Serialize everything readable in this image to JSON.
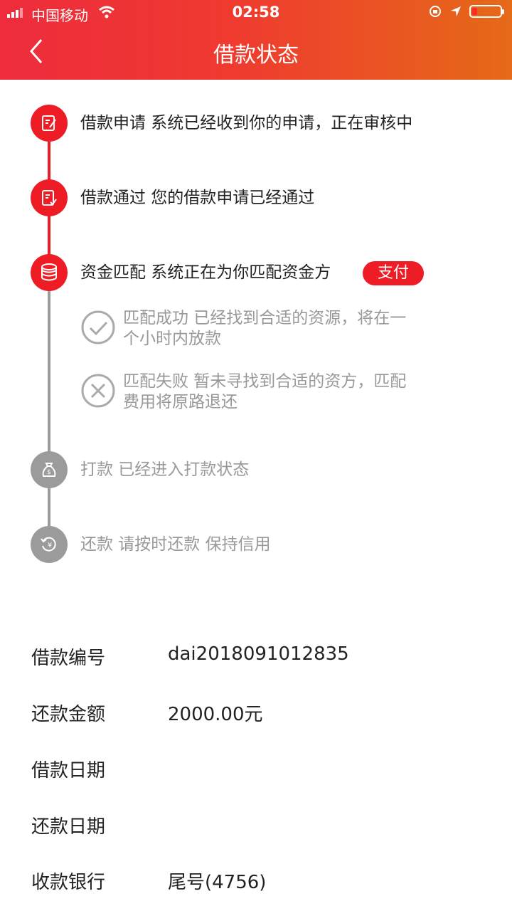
{
  "status_bar": {
    "carrier": "中国移动",
    "time": "02:58",
    "colors": {
      "battery_low": "#ff2a2a"
    }
  },
  "nav": {
    "title": "借款状态"
  },
  "colors": {
    "header_start": "#ee2c3c",
    "header_end": "#e56a17",
    "accent": "#ee1c25",
    "inactive": "#9b9b9b"
  },
  "steps": [
    {
      "icon": "document-edit-icon",
      "text": "借款申请  系统已经收到你的申请，正在审核中",
      "state": "done"
    },
    {
      "icon": "document-check-icon",
      "text": "借款通过  您的借款申请已经通过",
      "state": "done"
    },
    {
      "icon": "coins-icon",
      "text": "资金匹配 系统正在为你匹配资金方",
      "state": "current",
      "action_label": "支付"
    },
    {
      "icon": "money-bag-icon",
      "text": "打款 已经进入打款状态",
      "state": "pending"
    },
    {
      "icon": "repay-cycle-icon",
      "text": "还款 请按时还款 保持信用",
      "state": "pending"
    }
  ],
  "match_results": [
    {
      "icon": "check-circle-icon",
      "text": "匹配成功 已经找到合适的资源，将在一个小时内放款"
    },
    {
      "icon": "x-circle-icon",
      "text": "匹配失败 暂未寻找到合适的资方，匹配费用将原路退还"
    }
  ],
  "details": [
    {
      "label": "借款编号",
      "value": "dai2018091012835"
    },
    {
      "label": "还款金额",
      "value": "2000.00元"
    },
    {
      "label": "借款日期",
      "value": ""
    },
    {
      "label": "还款日期",
      "value": ""
    },
    {
      "label": "收款银行",
      "value": "尾号(4756)"
    }
  ]
}
